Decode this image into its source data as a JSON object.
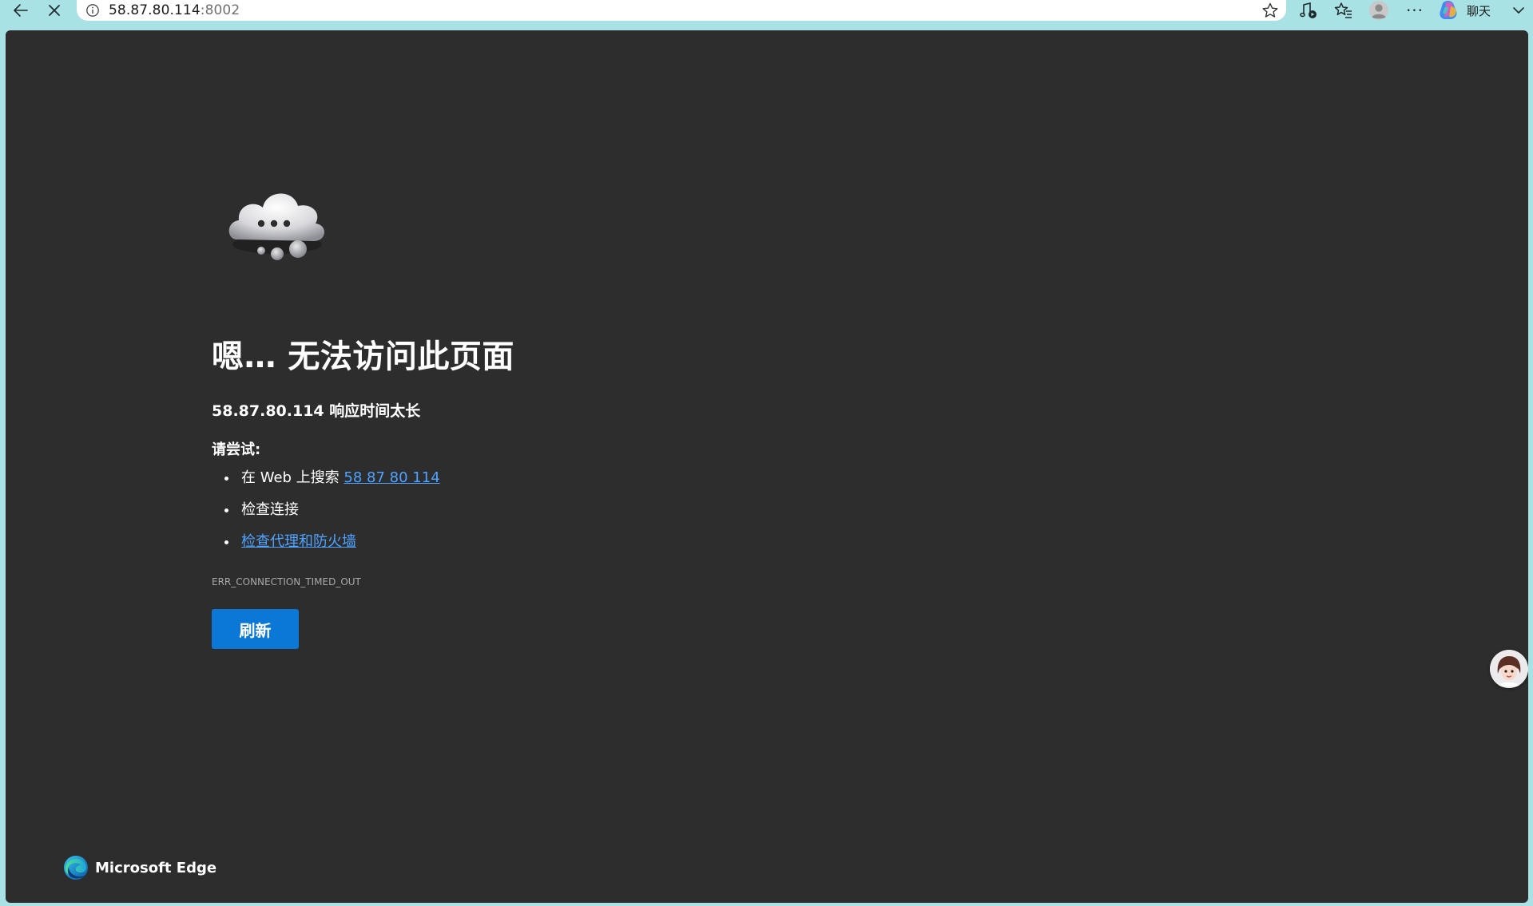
{
  "toolbar": {
    "url_host": "58.87.80.114",
    "url_port": ":8002",
    "copilot_label": "聊天",
    "more_label": "···",
    "icons": {
      "back": "arrow-left-icon",
      "stop": "close-icon",
      "site_info": "info-icon",
      "favorite": "star-icon",
      "read_aloud": "read-aloud-icon",
      "favorites_list": "favorites-icon",
      "profile": "profile-icon",
      "more": "ellipsis-icon",
      "copilot": "copilot-icon",
      "dropdown": "chevron-down-icon"
    }
  },
  "error_page": {
    "title": "嗯… 无法访问此页面",
    "detail": "58.87.80.114 响应时间太长",
    "suggest_heading": "请尝试:",
    "suggestions": [
      {
        "prefix": "在 Web 上搜索 ",
        "link": "58 87 80 114"
      },
      {
        "text": "检查连接"
      },
      {
        "link": "检查代理和防火墙"
      }
    ],
    "error_code": "ERR_CONNECTION_TIMED_OUT",
    "refresh_label": "刷新"
  },
  "branding": {
    "name": "Microsoft Edge"
  },
  "colors": {
    "frame": "#a9e2e4",
    "page_bg": "#2d2d2e",
    "link": "#4fa3ff",
    "button": "#0b77d6"
  }
}
